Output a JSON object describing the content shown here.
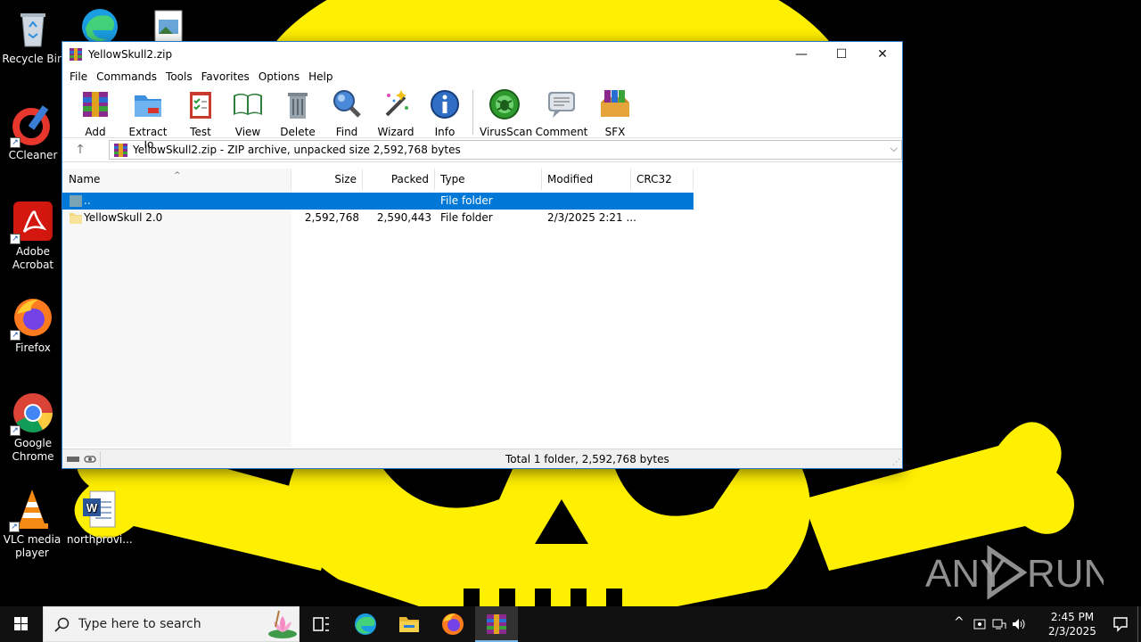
{
  "desktop": {
    "icons": [
      {
        "label": "Recycle Bin"
      },
      {
        "label": "CCleaner"
      },
      {
        "label": "Adobe Acrobat"
      },
      {
        "label": "Firefox"
      },
      {
        "label": "Google Chrome"
      },
      {
        "label": "VLC media player"
      },
      {
        "label": "northprovi..."
      }
    ]
  },
  "window": {
    "title": "YellowSkull2.zip",
    "controls": {
      "minimize": "—",
      "maximize": "☐",
      "close": "✕"
    },
    "menu": [
      "File",
      "Commands",
      "Tools",
      "Favorites",
      "Options",
      "Help"
    ],
    "toolbar": [
      {
        "label": "Add",
        "icon": "add-archive-icon"
      },
      {
        "label": "Extract To",
        "icon": "extract-folder-icon"
      },
      {
        "label": "Test",
        "icon": "test-clipboard-icon"
      },
      {
        "label": "View",
        "icon": "view-book-icon"
      },
      {
        "label": "Delete",
        "icon": "trash-icon"
      },
      {
        "label": "Find",
        "icon": "magnifier-icon"
      },
      {
        "label": "Wizard",
        "icon": "wand-icon"
      },
      {
        "label": "Info",
        "icon": "info-icon"
      },
      {
        "label": "VirusScan",
        "icon": "virus-scan-icon"
      },
      {
        "label": "Comment",
        "icon": "comment-icon"
      },
      {
        "label": "SFX",
        "icon": "sfx-box-icon"
      }
    ],
    "address": "YellowSkull2.zip - ZIP archive, unpacked size 2,592,768 bytes",
    "columns": {
      "name": "Name",
      "size": "Size",
      "packed": "Packed",
      "type": "Type",
      "modified": "Modified",
      "crc": "CRC32"
    },
    "rows": [
      {
        "name": "..",
        "size": "",
        "packed": "",
        "type": "File folder",
        "modified": "",
        "crc": "",
        "selected": true
      },
      {
        "name": "YellowSkull 2.0",
        "size": "2,592,768",
        "packed": "2,590,443",
        "type": "File folder",
        "modified": "2/3/2025 2:21 ...",
        "crc": "",
        "selected": false
      }
    ],
    "status": "Total 1 folder, 2,592,768 bytes"
  },
  "taskbar": {
    "search_placeholder": "Type here to search",
    "time": "2:45 PM",
    "date": "2/3/2025"
  },
  "watermark": {
    "left": "ANY",
    "right": "RUN"
  },
  "colors": {
    "wallpaper_yellow": "#ffef00",
    "selection": "#0078d7",
    "taskbar": "#121212"
  }
}
